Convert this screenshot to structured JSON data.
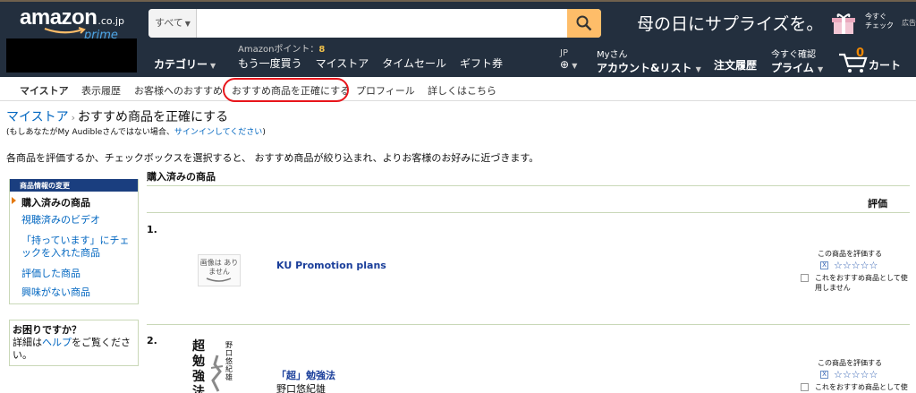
{
  "header": {
    "logo_word": "amazon",
    "logo_suffix": ".co.jp",
    "logo_sub": "prime",
    "search": {
      "category": "すべて",
      "value": "",
      "placeholder": ""
    },
    "promo_text": "母の日にサプライズを。",
    "check_now_line1": "今すぐ",
    "check_now_line2": "チェック",
    "ad_label": "広告",
    "points_label": "Amazonポイント：",
    "points_value": "8",
    "category_menu": "カテゴリー",
    "nav_links": [
      "もう一度買う",
      "マイストア",
      "タイムセール",
      "ギフト券"
    ],
    "lang": "JP",
    "account_line1": "Myさん",
    "account_line2": "アカウント&リスト",
    "orders": "注文履歴",
    "prime_line1": "今すぐ確認",
    "prime_line2": "プライム",
    "cart_count": "0",
    "cart_label": "カート",
    "accent_color": "#febd69",
    "bg_color": "#232f3e"
  },
  "subnav": {
    "items": [
      "マイストア",
      "表示履歴",
      "お客様へのおすすめ",
      "おすすめ商品を正確にする",
      "プロフィール",
      "詳しくはこちら"
    ],
    "highlight_color": "#e8151b"
  },
  "page": {
    "breadcrumb_link": "マイストア",
    "breadcrumb_sep": "›",
    "breadcrumb_current": "おすすめ商品を正確にする",
    "note_prefix": "(もしあなたがMy Audibleさんではない場合、",
    "note_link": "サインインしてください",
    "note_suffix": ")",
    "intro": "各商品を評価するか、チェックボックスを選択すると、 おすすめ商品が絞り込まれ、よりお客様のお好みに近づきます。"
  },
  "sidebar": {
    "header": "商品情報の変更",
    "selected": "購入済みの商品",
    "links": [
      "視聴済みのビデオ",
      "「持っています」にチェックを入れた商品",
      "評価した商品",
      "興味がない商品"
    ]
  },
  "help": {
    "title": "お困りですか？",
    "text_prefix": "詳細は",
    "link": "ヘルプ",
    "text_suffix": "をご覧ください。"
  },
  "list": {
    "section_title": "購入済みの商品",
    "rating_header": "評価",
    "rate_prompt": "この商品を評価する",
    "stars": "☆☆☆☆☆",
    "x_mark": "X",
    "not_use_label": "これをおすすめ商品として使用しません",
    "items": [
      {
        "num": "1.",
        "title": "KU Promotion plans",
        "author": "",
        "image_text": "画像は ありません"
      },
      {
        "num": "2.",
        "title": "「超」勉強法",
        "author": "野口悠紀雄",
        "cover_big": "超勉強法",
        "cover_author": "野口悠紀雄"
      }
    ]
  }
}
